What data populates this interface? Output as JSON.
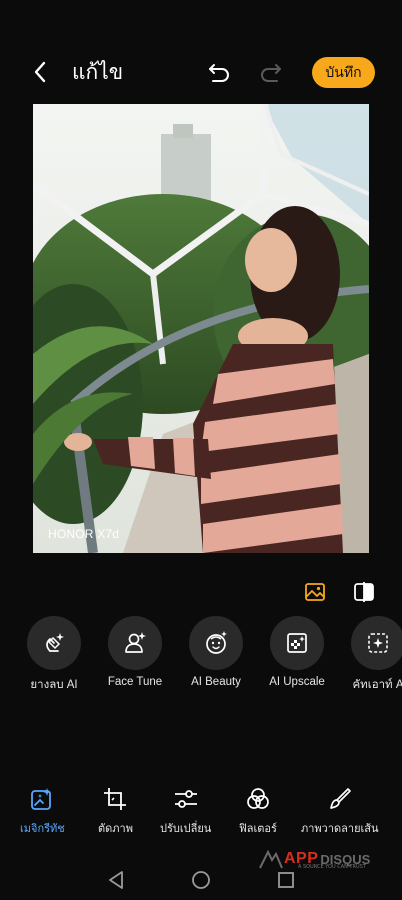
{
  "header": {
    "title": "แก้ไข",
    "save_label": "บันทึก"
  },
  "photo": {
    "watermark": "HONOR X7d"
  },
  "icons": {
    "back": "chevron-left-icon",
    "undo": "undo-icon",
    "redo": "redo-icon",
    "gallery": "image-icon",
    "compare": "compare-icon"
  },
  "tools": [
    {
      "label": "ยางลบ AI",
      "icon": "ai-eraser-icon"
    },
    {
      "label": "Face Tune",
      "icon": "face-tune-icon"
    },
    {
      "label": "AI Beauty",
      "icon": "ai-beauty-icon"
    },
    {
      "label": "AI Upscale",
      "icon": "ai-upscale-icon"
    },
    {
      "label": "คัทเอาท์ A",
      "icon": "ai-cutout-icon"
    }
  ],
  "tabs": [
    {
      "label": "เมจิกรีทัช",
      "icon": "magic-retouch-icon",
      "active": true
    },
    {
      "label": "ตัดภาพ",
      "icon": "crop-icon",
      "active": false
    },
    {
      "label": "ปรับเปลี่ยน",
      "icon": "adjust-icon",
      "active": false
    },
    {
      "label": "ฟิลเตอร์",
      "icon": "filter-icon",
      "active": false
    },
    {
      "label": "ภาพวาดลายเส้น",
      "icon": "brush-icon",
      "active": false
    }
  ],
  "logo": {
    "main": "APP",
    "sub": "DISQUS",
    "tagline": "A SOURCE YOU CAN TRUST"
  },
  "colors": {
    "accent": "#f7a81b",
    "active_tab": "#58a7ff",
    "background": "#0b0b0b",
    "tool_circle": "#2a2a2a"
  }
}
